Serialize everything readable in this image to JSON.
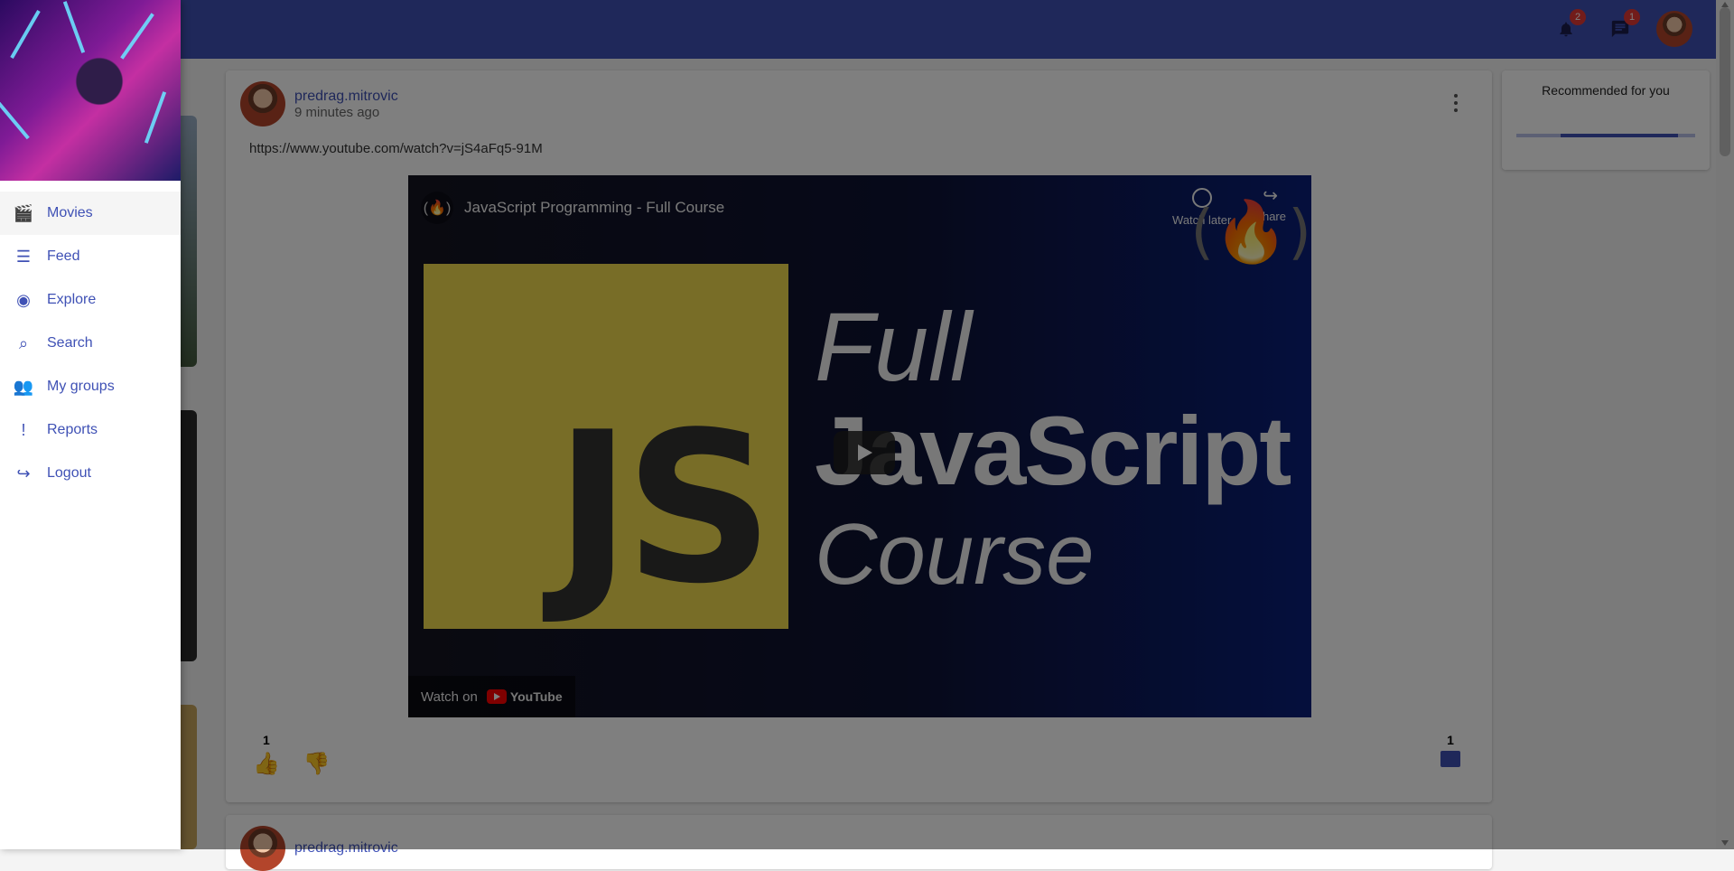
{
  "topbar": {
    "notifications_count": "2",
    "messages_count": "1"
  },
  "post": {
    "username": "predrag.mitrovic",
    "time": "9 minutes ago",
    "url": "https://www.youtube.com/watch?v=jS4aFq5-91M",
    "video": {
      "title": "JavaScript Programming - Full Course",
      "watch_later": "Watch later",
      "share": "Share",
      "logo_text": "(🔥)",
      "big_logo": "(🔥)",
      "js": "JS",
      "headline_1": "Full",
      "headline_2": "JavaScript",
      "headline_3": "Course",
      "watch_on": "Watch on",
      "youtube": "YouTube"
    },
    "likes": "1",
    "comments": "1"
  },
  "next_post": {
    "username": "predrag.mitrovic"
  },
  "recommended": {
    "title": "Recommended for you"
  },
  "drawer": {
    "items": [
      {
        "label": "Movies",
        "icon": "movie-icon"
      },
      {
        "label": "Feed",
        "icon": "feed-icon"
      },
      {
        "label": "Explore",
        "icon": "explore-icon"
      },
      {
        "label": "Search",
        "icon": "search-icon"
      },
      {
        "label": "My groups",
        "icon": "groups-icon"
      },
      {
        "label": "Reports",
        "icon": "report-icon"
      },
      {
        "label": "Logout",
        "icon": "logout-icon"
      }
    ]
  },
  "colors": {
    "primary": "#3f51b5",
    "badge": "#e53935",
    "js_yellow": "#f0db4f"
  }
}
